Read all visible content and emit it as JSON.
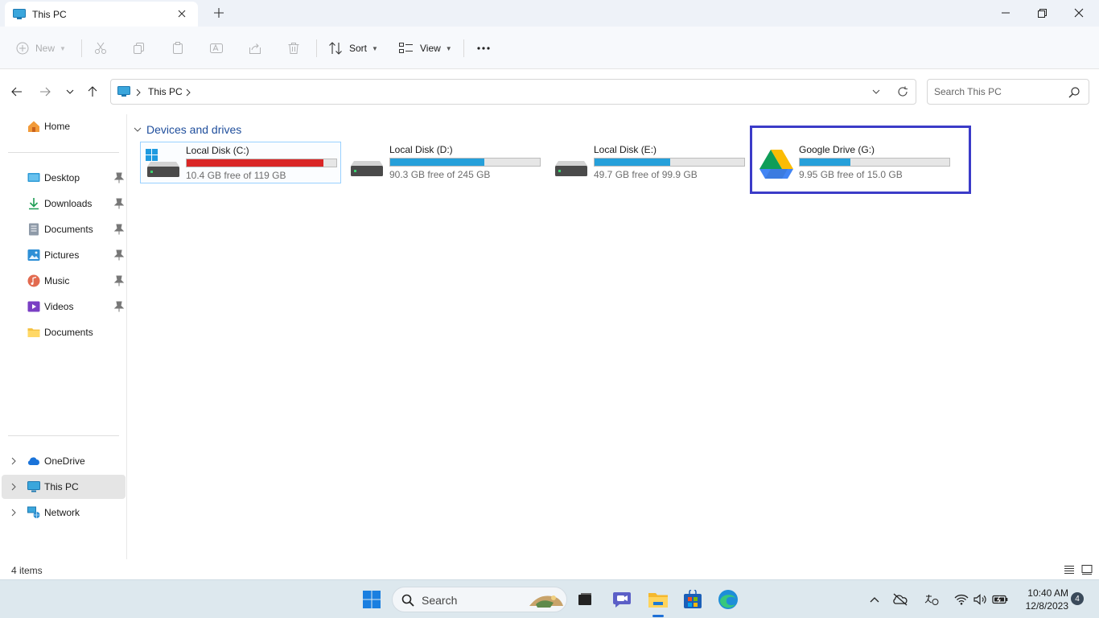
{
  "window": {
    "tab_title": "This PC"
  },
  "toolbar": {
    "new_label": "New",
    "sort_label": "Sort",
    "view_label": "View"
  },
  "address": {
    "breadcrumb": "This PC",
    "search_placeholder": "Search This PC"
  },
  "sidebar": {
    "home": "Home",
    "quick_access": [
      {
        "label": "Desktop",
        "icon": "desktop-icon",
        "pinned": true
      },
      {
        "label": "Downloads",
        "icon": "downloads-icon",
        "pinned": true
      },
      {
        "label": "Documents",
        "icon": "documents-icon",
        "pinned": true
      },
      {
        "label": "Pictures",
        "icon": "pictures-icon",
        "pinned": true
      },
      {
        "label": "Music",
        "icon": "music-icon",
        "pinned": true
      },
      {
        "label": "Videos",
        "icon": "videos-icon",
        "pinned": true
      },
      {
        "label": "Documents",
        "icon": "folder-icon",
        "pinned": false
      }
    ],
    "locations": [
      {
        "label": "OneDrive",
        "icon": "onedrive-icon",
        "selected": false
      },
      {
        "label": "This PC",
        "icon": "this-pc-icon",
        "selected": true
      },
      {
        "label": "Network",
        "icon": "network-icon",
        "selected": false
      }
    ]
  },
  "main": {
    "section_title": "Devices and drives",
    "drives": [
      {
        "name": "Local Disk (C:)",
        "free_text": "10.4 GB free of 119 GB",
        "used_fraction": 0.913,
        "icon": "windows-drive-icon",
        "nearly_full": true,
        "selected": true
      },
      {
        "name": "Local Disk (D:)",
        "free_text": "90.3 GB free of 245 GB",
        "used_fraction": 0.631,
        "icon": "hard-drive-icon",
        "nearly_full": false,
        "selected": false
      },
      {
        "name": "Local Disk (E:)",
        "free_text": "49.7 GB free of 99.9 GB",
        "used_fraction": 0.503,
        "icon": "hard-drive-icon",
        "nearly_full": false,
        "selected": false
      },
      {
        "name": "Google Drive (G:)",
        "free_text": "9.95 GB free of 15.0 GB",
        "used_fraction": 0.337,
        "icon": "google-drive-icon",
        "nearly_full": false,
        "selected": false
      }
    ],
    "highlight_color": "#3b3bc8"
  },
  "status": {
    "item_count": "4 items"
  },
  "taskbar": {
    "search_label": "Search",
    "time": "10:40 AM",
    "date": "12/8/2023",
    "notification_count": "4"
  },
  "colors": {
    "accent": "#26a0da",
    "full_drive": "#da2626",
    "section_header": "#1f4e9c"
  }
}
